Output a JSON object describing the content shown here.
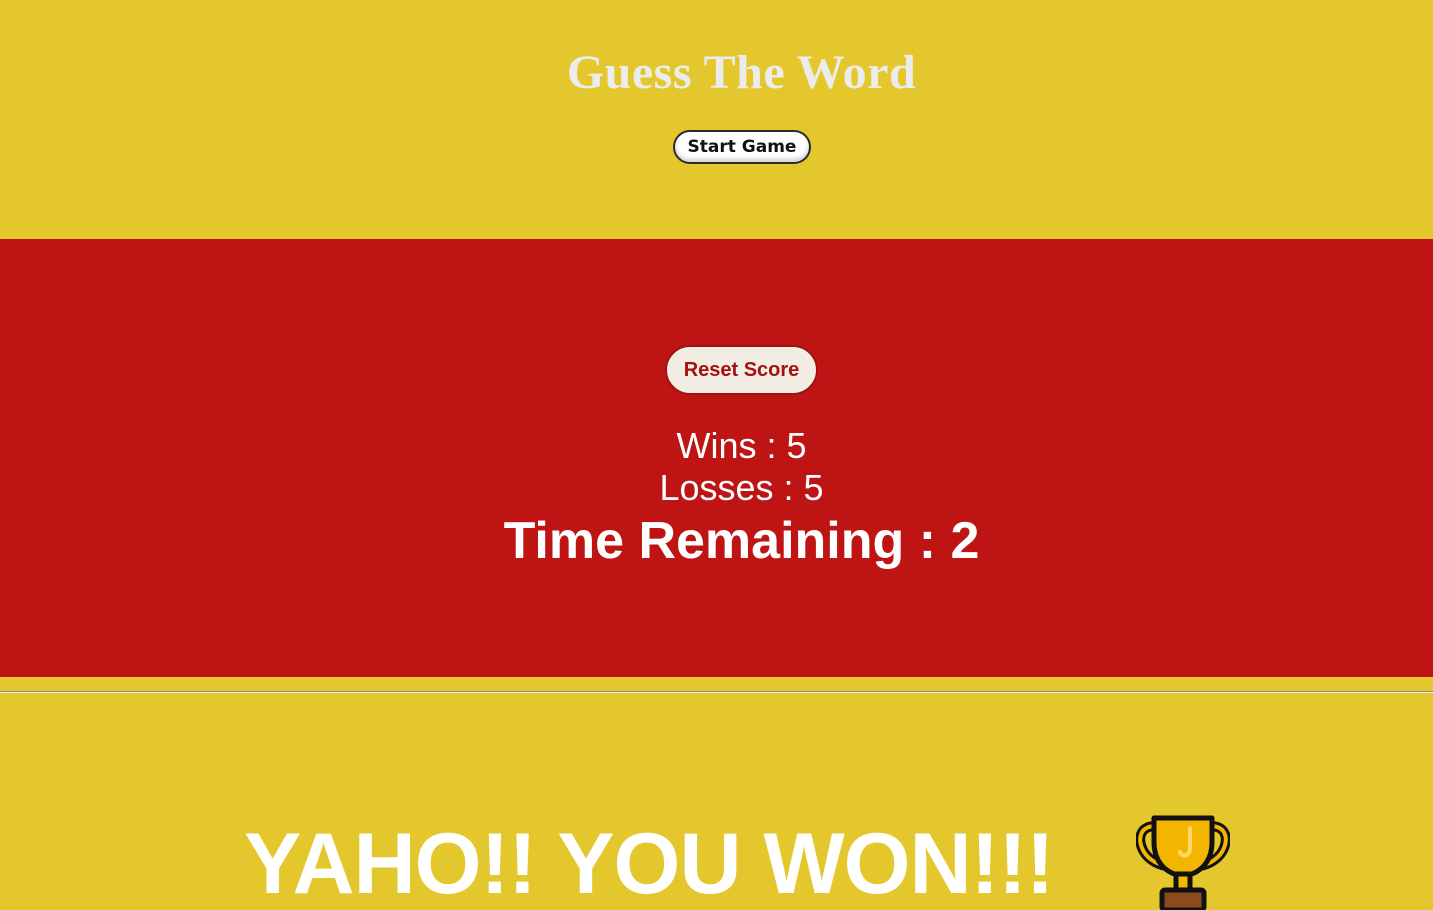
{
  "app": {
    "title": "Guess The Word",
    "start_label": "Start Game"
  },
  "score": {
    "reset_label": "Reset Score",
    "wins_text": "Wins : 5",
    "losses_text": "Losses : 5",
    "timer_text": "Time Remaining : 2"
  },
  "result": {
    "message": "YAHO!! YOU WON!!!",
    "icon": "trophy-icon"
  },
  "colors": {
    "background": "#e3c72c",
    "panel": "#be1414",
    "title": "#ececec",
    "reset_text": "#a51111",
    "trophy": "#f4b500"
  }
}
